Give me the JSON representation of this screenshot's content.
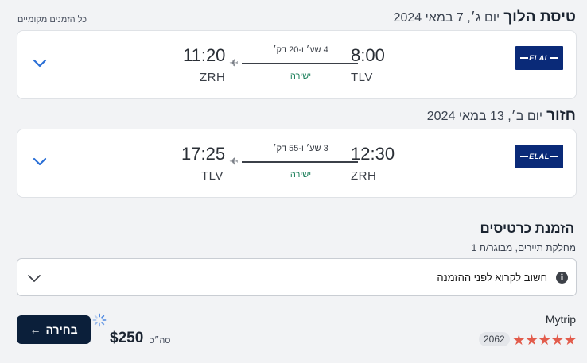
{
  "outbound": {
    "title": "טיסת הלוך",
    "date": "יום ג׳, 7 במאי 2024",
    "local_bookings_link": "כל הזמנים מקומיים",
    "airline_logo_text": "ELAL",
    "depart_time": "8:00",
    "depart_code": "TLV",
    "arrive_time": "11:20",
    "arrive_code": "ZRH",
    "duration": "4 שע׳ ו-20 דק׳",
    "stops": "ישירה"
  },
  "return": {
    "title": "חזור",
    "date": "יום ב׳, 13 במאי 2024",
    "airline_logo_text": "ELAL",
    "depart_time": "12:30",
    "depart_code": "ZRH",
    "arrive_time": "17:25",
    "arrive_code": "TLV",
    "duration": "3 שע׳ ו-55 דק׳",
    "stops": "ישירה"
  },
  "booking": {
    "title": "הזמנת כרטיסים",
    "subtitle": "מחלקת תיירים, מבוגר/ת 1",
    "notice": "חשוב לקרוא לפני ההזמנה",
    "info_icon": "i"
  },
  "offer": {
    "select_label": "בחירה",
    "select_arrow": "←",
    "price": "$250",
    "total_label": "סה״כ",
    "provider": "Mytrip",
    "stars": [
      "★",
      "★",
      "★",
      "★",
      "★"
    ],
    "rating_stars": 5,
    "review_count": "2062"
  },
  "colors": {
    "primary": "#0b1f3a",
    "airline": "#0a2a78",
    "direct": "#1b7f5a",
    "stars": "#e25b4b",
    "chevron": "#2a6fd6"
  }
}
